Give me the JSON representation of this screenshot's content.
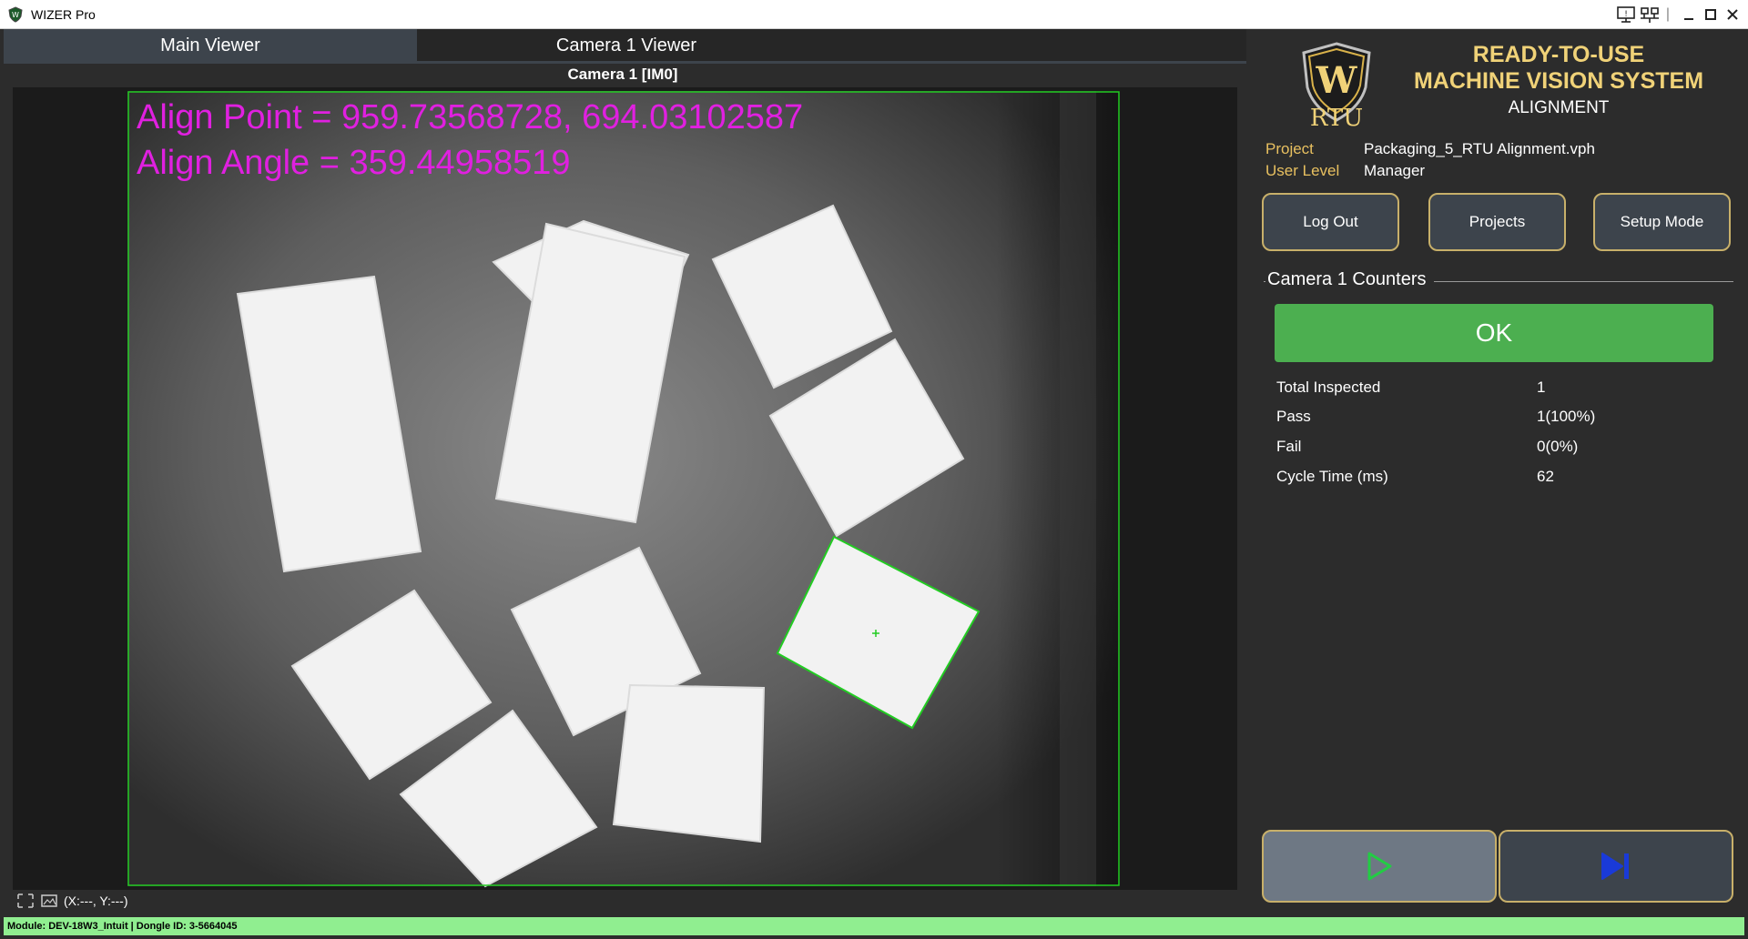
{
  "window": {
    "title": "WIZER Pro"
  },
  "tabs": [
    {
      "label": "Main Viewer",
      "active": true
    },
    {
      "label": "Camera 1 Viewer",
      "active": false
    }
  ],
  "viewer": {
    "label": "Camera 1  [IM0]",
    "overlay": {
      "align_point": "Align Point = 959.73568728, 694.03102587",
      "align_angle": "Align Angle = 359.44958519",
      "color": "#e020e0"
    },
    "coords": "(X:---, Y:---)"
  },
  "brand": {
    "line1": "READY-TO-USE",
    "line2": "MACHINE VISION SYSTEM",
    "line3": "ALIGNMENT",
    "logo_text": "RTU",
    "logo_letter": "W",
    "accent": "#f0d278"
  },
  "project_info": {
    "project_label": "Project",
    "project_value": "Packaging_5_RTU Alignment.vph",
    "user_level_label": "User Level",
    "user_level_value": "Manager"
  },
  "buttons": {
    "log_out": "Log Out",
    "projects": "Projects",
    "setup_mode": "Setup Mode"
  },
  "counters": {
    "title": "Camera 1 Counters",
    "result": "OK",
    "result_color": "#4caf50",
    "rows": [
      {
        "label": "Total Inspected",
        "value": "1"
      },
      {
        "label": "Pass",
        "value": "1(100%)"
      },
      {
        "label": "Fail",
        "value": "0(0%)"
      },
      {
        "label": "Cycle Time (ms)",
        "value": "62"
      }
    ]
  },
  "run_controls": {
    "run_icon": "play-icon",
    "step_icon": "step-forward-icon",
    "run_color": "#22cc44",
    "step_color": "#1a3ad8"
  },
  "status_bar": {
    "text": "Module: DEV-18W3_Intuit | Dongle ID: 3-5664045",
    "color": "#90ee90"
  }
}
